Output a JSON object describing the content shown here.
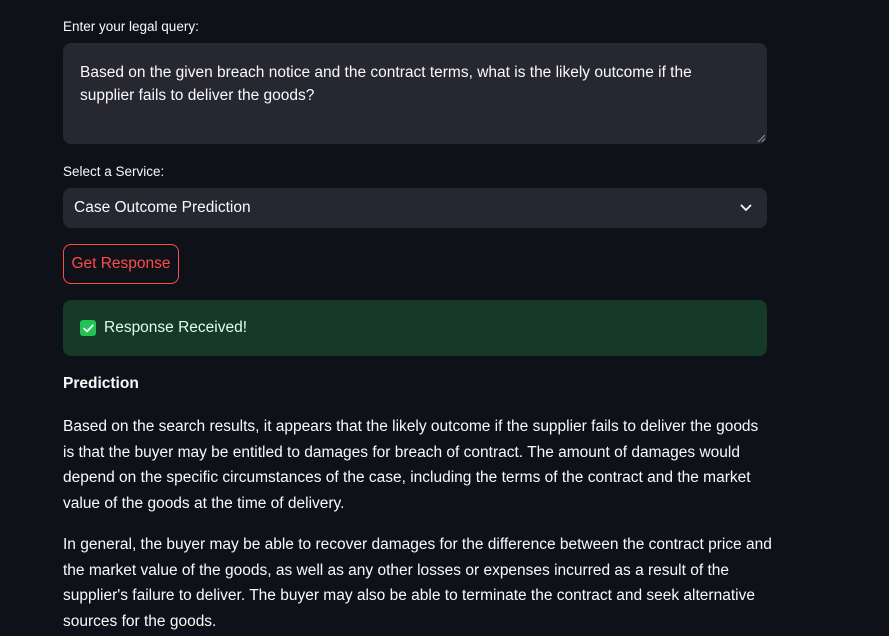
{
  "query": {
    "label": "Enter your legal query:",
    "value": "Based on the given breach notice and the contract terms, what is the likely outcome if the supplier fails to deliver the goods?"
  },
  "service": {
    "label": "Select a Service:",
    "selected": "Case Outcome Prediction"
  },
  "actions": {
    "get_response_label": "Get Response"
  },
  "status": {
    "message": "Response Received!",
    "icon": "check-box-icon"
  },
  "result": {
    "heading": "Prediction",
    "paragraphs": [
      "Based on the search results, it appears that the likely outcome if the supplier fails to deliver the goods is that the buyer may be entitled to damages for breach of contract. The amount of damages would depend on the specific circumstances of the case, including the terms of the contract and the market value of the goods at the time of delivery.",
      "In general, the buyer may be able to recover damages for the difference between the contract price and the market value of the goods, as well as any other losses or expenses incurred as a result of the supplier's failure to deliver. The buyer may also be able to terminate the contract and seek alternative sources for the goods."
    ]
  },
  "colors": {
    "background": "#0e1117",
    "input_bg": "#262730",
    "accent": "#ff4b4b",
    "success_bg": "#173928",
    "success_icon": "#21c354"
  }
}
